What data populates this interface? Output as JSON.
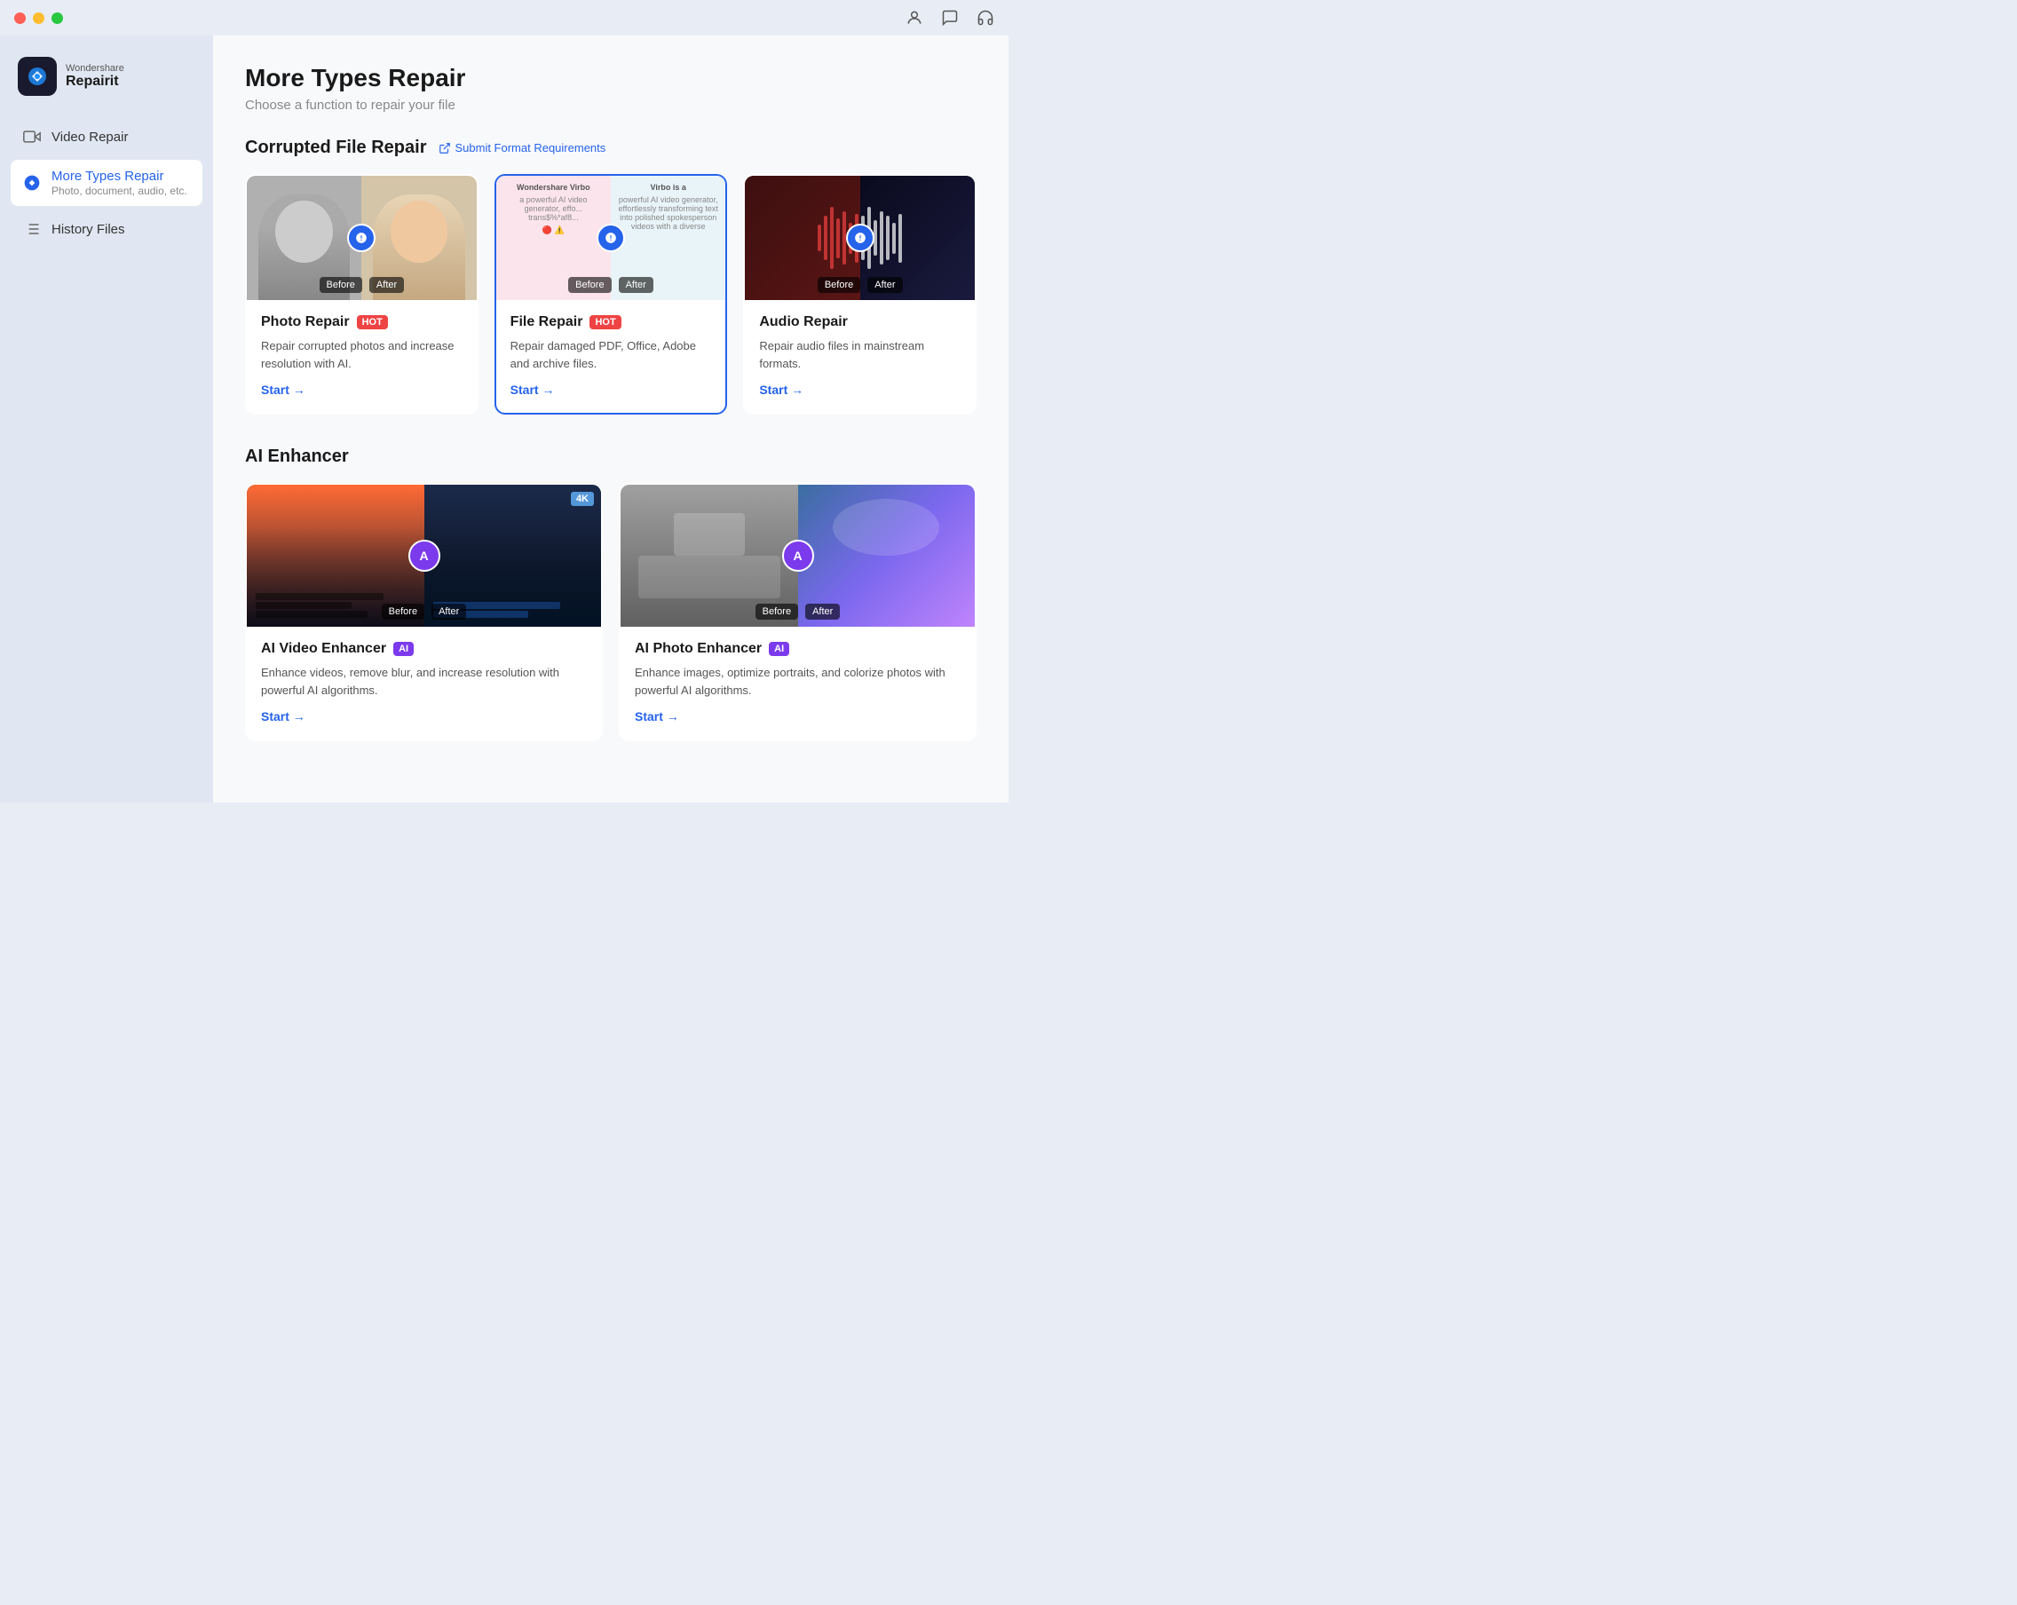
{
  "window": {
    "title": "Wondershare Repairit"
  },
  "titlebar": {
    "brand": "Wondershare",
    "product": "Repairit"
  },
  "nav": {
    "items": [
      {
        "id": "video-repair",
        "label": "Video Repair",
        "sub": "",
        "active": false
      },
      {
        "id": "more-types-repair",
        "label": "More Types Repair",
        "sub": "Photo, document, audio, etc.",
        "active": true
      },
      {
        "id": "history-files",
        "label": "History Files",
        "sub": "",
        "active": false
      }
    ]
  },
  "main": {
    "title": "More Types Repair",
    "subtitle": "Choose a function to repair your file",
    "corrupted_section": {
      "title": "Corrupted File Repair",
      "submit_link": "Submit Format Requirements",
      "cards": [
        {
          "id": "photo-repair",
          "title": "Photo Repair",
          "badge": "HOT",
          "badge_type": "hot",
          "desc": "Repair corrupted photos and increase resolution with AI.",
          "start_label": "Start →",
          "selected": false
        },
        {
          "id": "file-repair",
          "title": "File Repair",
          "badge": "HOT",
          "badge_type": "hot",
          "desc": "Repair damaged PDF, Office, Adobe and archive files.",
          "start_label": "Start →",
          "selected": true
        },
        {
          "id": "audio-repair",
          "title": "Audio Repair",
          "badge": "",
          "badge_type": "",
          "desc": "Repair audio files in mainstream formats.",
          "start_label": "Start →",
          "selected": false
        }
      ]
    },
    "ai_section": {
      "title": "AI Enhancer",
      "cards": [
        {
          "id": "ai-video-enhancer",
          "title": "AI Video Enhancer",
          "badge": "AI",
          "badge_type": "ai",
          "desc": "Enhance videos, remove blur, and increase resolution with powerful AI algorithms.",
          "start_label": "Start →",
          "extra_badge": "4K"
        },
        {
          "id": "ai-photo-enhancer",
          "title": "AI Photo Enhancer",
          "badge": "AI",
          "badge_type": "ai",
          "desc": "Enhance images, optimize portraits, and colorize photos with powerful AI algorithms.",
          "start_label": "Start →",
          "extra_badge": ""
        }
      ]
    }
  }
}
